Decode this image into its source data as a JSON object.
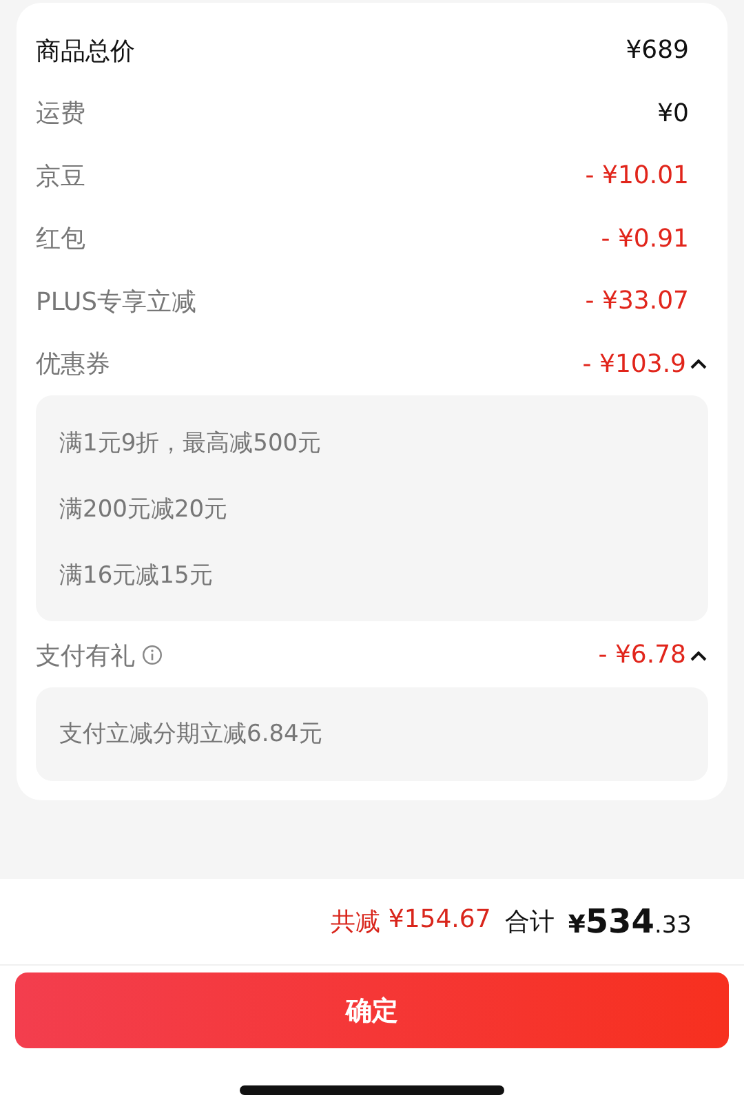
{
  "rows": [
    {
      "label": "商品总价",
      "amount": "¥689",
      "kind": "total"
    },
    {
      "label": "运费",
      "amount": "¥0",
      "kind": "plain"
    },
    {
      "label": "京豆",
      "amount": "- ¥10.01",
      "kind": "discount"
    },
    {
      "label": "红包",
      "amount": "- ¥0.91",
      "kind": "discount"
    },
    {
      "label": "PLUS专享立减",
      "amount": "- ¥33.07",
      "kind": "discount"
    },
    {
      "label": "优惠券",
      "amount": "- ¥103.9",
      "kind": "discount",
      "expanded": true,
      "details": [
        "满1元9折，最高减500元",
        "满200元减20元",
        "满16元减15元"
      ]
    },
    {
      "label": "支付有礼",
      "amount": "- ¥6.78",
      "kind": "discount",
      "info": true,
      "expanded": true,
      "details": [
        "支付立减分期立减6.84元"
      ]
    }
  ],
  "footer": {
    "saved_label": "共减",
    "saved_amount": "¥154.67",
    "total_label": "合计",
    "total_currency": "¥",
    "total_integer": "534",
    "total_decimal": ".33"
  },
  "confirm_button": "确定"
}
